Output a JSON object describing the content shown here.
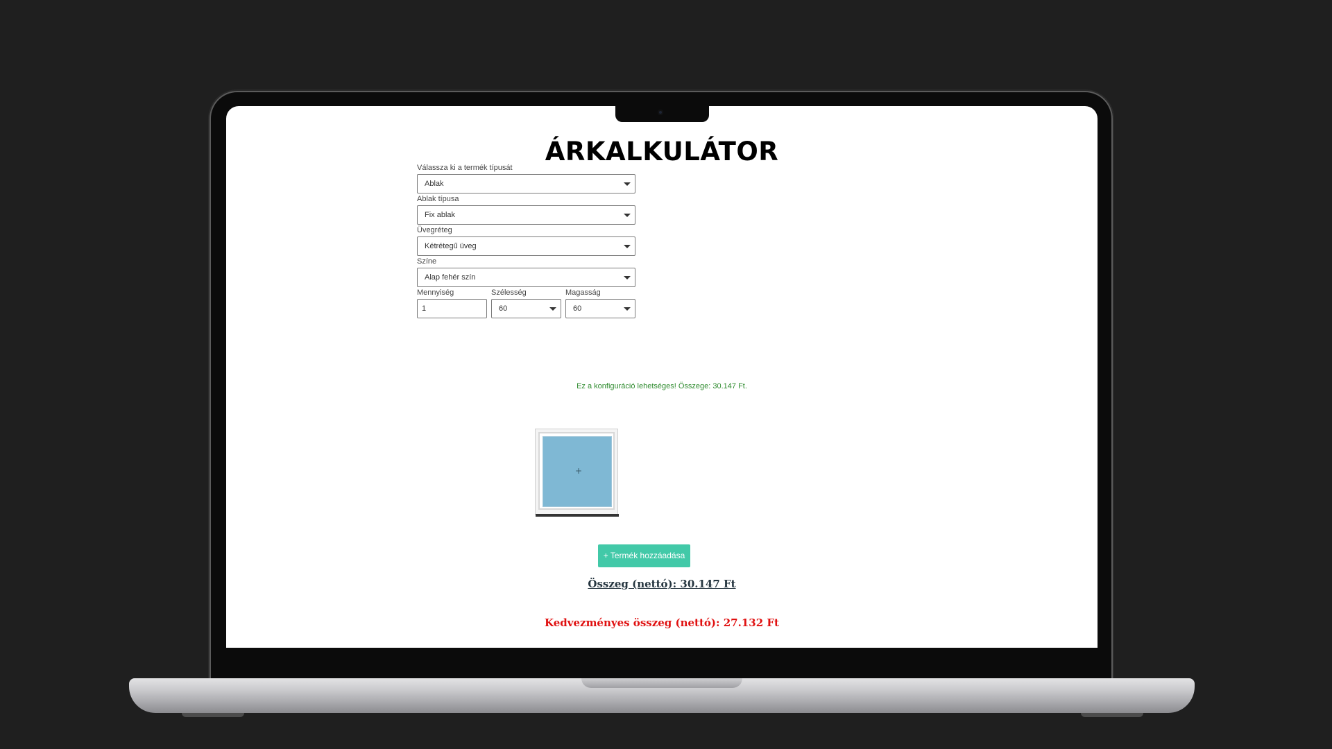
{
  "page": {
    "title": "ÁRKALKULÁTOR",
    "fields": {
      "product_type": {
        "label": "Válassza ki a termék típusát",
        "value": "Ablak"
      },
      "window_type": {
        "label": "Ablak típusa",
        "value": "Fix ablak"
      },
      "glazing": {
        "label": "Üvegréteg",
        "value": "Kétrétegű üveg"
      },
      "color": {
        "label": "Színe",
        "value": "Alap fehér szín"
      },
      "quantity": {
        "label": "Mennyiség",
        "value": "1"
      },
      "width": {
        "label": "Szélesség",
        "value": "60"
      },
      "height": {
        "label": "Magasság",
        "value": "60"
      }
    },
    "status_message": "Ez a konfiguráció lehetséges! Összege: 30.147 Ft.",
    "preview": {
      "plus": "+"
    },
    "add_button_label": "+ Termék hozzáadása",
    "total": "Összeg (nettó): 30.147 Ft",
    "discount_total": "Kedvezményes összeg (nettó): 27.132 Ft"
  },
  "colors": {
    "accent": "#42c9a8",
    "success": "#2e8b2e",
    "discount": "#e01010",
    "glass": "#7fb8d4"
  }
}
